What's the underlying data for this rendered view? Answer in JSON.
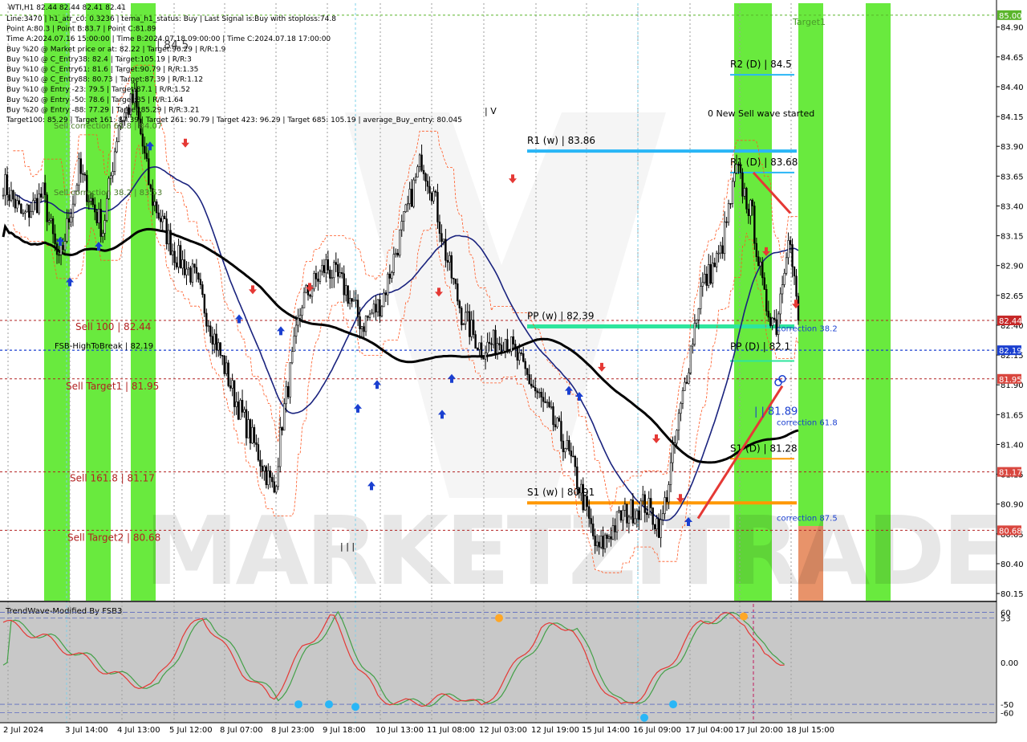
{
  "chart_data": [
    {
      "type": "candlestick",
      "symbol_timeframe": "WTI,H1",
      "ohlc_header": "82.44 82.44 82.41 82.41",
      "header_lines": [
        "Line:3470  | h1_atr_c0: 0.3236  | tema_h1_status: Buy  | Last Signal is:Buy with stoploss:74.8",
        "Point A:80.3  | Point B:83.7  | Point C:81.89",
        "Time A:2024.07.16 15:00:00  | Time B:2024.07.18 09:00:00  | Time C:2024.07.18 17:00:00",
        "Buy %20 @ Market price or at: 82.22  | Target:96.29  | R/R:1.9",
        "Buy %10 @ C_Entry38: 82.4  | Target:105.19  | R/R:3",
        "Buy %10 @ C_Entry61: 81.6  | Target:90.79  | R/R:1.35",
        "Buy %10 @ C_Entry88: 80.73  | Target:87.39  | R/R:1.12",
        "Buy %10 @ Entry -23: 79.5  | Target:87.1  | R/R:1.52",
        "Buy %20 @ Entry -50: 78.6  | Target:85  | R/R:1.64",
        "Buy %20 @ Entry -88: 77.29  | Target:85.29  | R/R:3.21",
        "Target100: 85.29  | Target 161: 87.39  | Target 261: 90.79  | Target 423: 96.29  | Target 685: 105.19  | average_Buy_entry: 80.045"
      ],
      "y_ticks": [
        84.9,
        84.65,
        84.4,
        84.15,
        83.9,
        83.65,
        83.4,
        83.15,
        82.9,
        82.65,
        82.4,
        82.15,
        81.9,
        81.65,
        81.4,
        81.15,
        80.9,
        80.65,
        80.4,
        80.15
      ],
      "y_tick_labels": [
        "84.90",
        "84.65",
        "84.40",
        "84.15",
        "83.90",
        "83.65",
        "83.40",
        "83.15",
        "82.90",
        "82.65",
        "82.40",
        "82.15",
        "81.90",
        "81.65",
        "81.40",
        "81.15",
        "80.90",
        "80.65",
        "80.40",
        "80.15"
      ],
      "ylim": [
        80.09,
        85.1
      ],
      "x_labels": [
        "2 Jul 2024",
        "3 Jul 14:00",
        "4 Jul 13:00",
        "5 Jul 12:00",
        "8 Jul 07:00",
        "8 Jul 23:00",
        "9 Jul 18:00",
        "10 Jul 13:00",
        "11 Jul 08:00",
        "12 Jul 03:00",
        "12 Jul 19:00",
        "15 Jul 14:00",
        "16 Jul 09:00",
        "17 Jul 04:00",
        "17 Jul 20:00",
        "18 Jul 15:00"
      ],
      "price_tags": [
        {
          "value": 85.0,
          "label": "85.00",
          "color": "#5ab52a"
        },
        {
          "value": 82.44,
          "label": "82.44",
          "color": "#c62828"
        },
        {
          "value": 82.19,
          "label": "82.19",
          "color": "#1a3fd0"
        },
        {
          "value": 81.95,
          "label": "81.95",
          "color": "#d9473f"
        },
        {
          "value": 81.17,
          "label": "81.17",
          "color": "#d9473f"
        },
        {
          "value": 80.68,
          "label": "80.68",
          "color": "#d9473f"
        }
      ],
      "h_lines": [
        {
          "value": 85.0,
          "color": "#5ab52a",
          "label": "Target1"
        },
        {
          "value": 82.44,
          "color": "#b22222",
          "label": "Sell 100 | 82.44"
        },
        {
          "value": 82.19,
          "color": "#1a3fd0",
          "label": "FSB-HighToBreak | 82.19"
        },
        {
          "value": 81.95,
          "color": "#b22222",
          "label": "Sell Target1 | 81.95"
        },
        {
          "value": 81.17,
          "color": "#b22222",
          "label": "Sell 161.8 | 81.17"
        },
        {
          "value": 80.68,
          "color": "#b22222",
          "label": "Sell Target2 | 80.68"
        }
      ],
      "pivot_levels": [
        {
          "label": "R2 (D) | 84.5",
          "value": 84.5,
          "color": "#29b6f6"
        },
        {
          "label": "R1 (w) | 83.86",
          "value": 83.86,
          "color": "#29b6f6"
        },
        {
          "label": "R1 (D) | 83.68",
          "value": 83.68,
          "color": "#29b6f6"
        },
        {
          "label": "PP (w) | 82.39",
          "value": 82.39,
          "color": "#2ee59d"
        },
        {
          "label": "PP (D) | 82.1",
          "value": 82.1,
          "color": "#2ee59d"
        },
        {
          "label": "S1 (D) | 81.28",
          "value": 81.28,
          "color": "#ff9800"
        },
        {
          "label": "S1 (w) | 80.91",
          "value": 80.91,
          "color": "#ff9800"
        }
      ],
      "annotations": [
        {
          "text": "0 New Sell wave started",
          "color": "#000000"
        },
        {
          "text": "correction 38.2",
          "color": "#1a3fd0"
        },
        {
          "text": "correction 61.8",
          "color": "#1a3fd0"
        },
        {
          "text": "correction 87.5",
          "color": "#1a3fd0"
        },
        {
          "text": "| | 81.89",
          "color": "#1a3fd0"
        },
        {
          "text": "Sell correction 61.8 | 84.07",
          "color": "#4a7a2a"
        },
        {
          "text": "Sell correction 38.2 | 83.53",
          "color": "#4a7a2a"
        },
        {
          "text": "| V",
          "color": "#000000"
        },
        {
          "text": "| | |",
          "color": "#000000"
        },
        {
          "text": "| 84.5",
          "color": "#444444"
        }
      ],
      "watermark": "MARKETZITRADE",
      "close": [
        82.44
      ]
    },
    {
      "type": "line",
      "title": "TrendWave-Modified By FSB3",
      "y_ticks": [
        60,
        53,
        0,
        -50,
        -60
      ],
      "y_tick_labels": [
        "60",
        "53",
        "0.00",
        "-50",
        "-60"
      ],
      "ylim": [
        -72,
        70
      ],
      "series": [
        {
          "color": "#e53935"
        },
        {
          "color": "#43a047"
        }
      ]
    }
  ]
}
